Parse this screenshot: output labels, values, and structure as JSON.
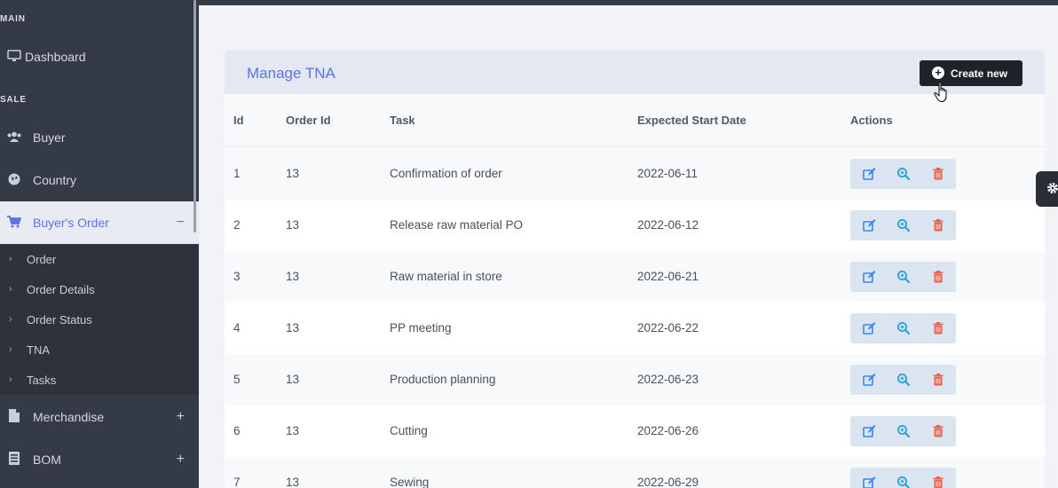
{
  "sidebar": {
    "sections": {
      "main": "MAIN",
      "sale": "SALE"
    },
    "items": {
      "dashboard": "Dashboard",
      "buyer": "Buyer",
      "country": "Country",
      "buyers_order": "Buyer's Order",
      "merchandise": "Merchandise",
      "bom": "BOM"
    },
    "toggles": {
      "buyers_order": "−",
      "merchandise": "+",
      "bom": "+"
    },
    "submenu": [
      "Order",
      "Order Details",
      "Order Status",
      "TNA",
      "Tasks"
    ]
  },
  "page": {
    "title": "Manage TNA",
    "create_label": "Create new"
  },
  "table": {
    "headers": [
      "Id",
      "Order Id",
      "Task",
      "Expected Start Date",
      "Actions"
    ],
    "rows": [
      {
        "id": "1",
        "order_id": "13",
        "task": "Confirmation of order",
        "date": "2022-06-11"
      },
      {
        "id": "2",
        "order_id": "13",
        "task": "Release raw material PO",
        "date": "2022-06-12"
      },
      {
        "id": "3",
        "order_id": "13",
        "task": "Raw material in store",
        "date": "2022-06-21"
      },
      {
        "id": "4",
        "order_id": "13",
        "task": "PP meeting",
        "date": "2022-06-22"
      },
      {
        "id": "5",
        "order_id": "13",
        "task": "Production planning",
        "date": "2022-06-23"
      },
      {
        "id": "6",
        "order_id": "13",
        "task": "Cutting",
        "date": "2022-06-26"
      },
      {
        "id": "7",
        "order_id": "13",
        "task": "Sewing",
        "date": "2022-06-29"
      }
    ]
  },
  "colors": {
    "accent": "#5c73e0",
    "edit_icon": "#3a86f0",
    "view_icon": "#2aa0d6",
    "delete_icon": "#e8614f"
  },
  "icons": {
    "dashboard": "monitor-icon",
    "buyer": "users-icon",
    "country": "globe-icon",
    "buyers_order": "cart-icon",
    "merchandise": "file-icon",
    "bom": "list-icon",
    "edit": "edit-icon",
    "view": "zoom-icon",
    "delete": "trash-icon"
  }
}
